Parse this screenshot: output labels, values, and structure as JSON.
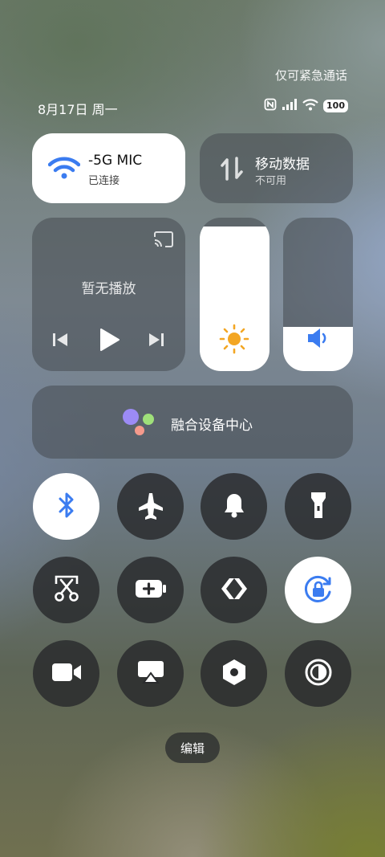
{
  "status_bar": {
    "emergency_text": "仅可紧急通话",
    "date_text": "8月17日 周一",
    "battery_level": "100"
  },
  "wifi": {
    "network_name": "-5G     MIC",
    "status": "已连接",
    "accent_color": "#3b7cf0"
  },
  "mobile_data": {
    "title": "移动数据",
    "status": "不可用"
  },
  "media": {
    "status_text": "暂无播放"
  },
  "brightness": {
    "level": 0.94
  },
  "volume": {
    "level": 0.29
  },
  "fusion_center": {
    "label": "融合设备中心"
  },
  "toggles": [
    {
      "name": "bluetooth",
      "icon": "bluetooth-icon",
      "on": true
    },
    {
      "name": "airplane-mode",
      "icon": "airplane-icon",
      "on": false
    },
    {
      "name": "ring-mode",
      "icon": "bell-icon",
      "on": false
    },
    {
      "name": "flashlight",
      "icon": "flashlight-icon",
      "on": false
    },
    {
      "name": "screenshot",
      "icon": "scissors-icon",
      "on": false
    },
    {
      "name": "battery-saver",
      "icon": "battery-plus-icon",
      "on": false
    },
    {
      "name": "nearby-share",
      "icon": "share-arrows-icon",
      "on": false
    },
    {
      "name": "rotation-lock",
      "icon": "rotation-lock-icon",
      "on": true
    },
    {
      "name": "screen-record",
      "icon": "video-camera-icon",
      "on": false
    },
    {
      "name": "screen-cast",
      "icon": "airplay-icon",
      "on": false
    },
    {
      "name": "nfc-settings",
      "icon": "hexagon-nut-icon",
      "on": false
    },
    {
      "name": "dark-mode",
      "icon": "contrast-icon",
      "on": false
    }
  ],
  "edit_button": {
    "label": "编辑"
  }
}
